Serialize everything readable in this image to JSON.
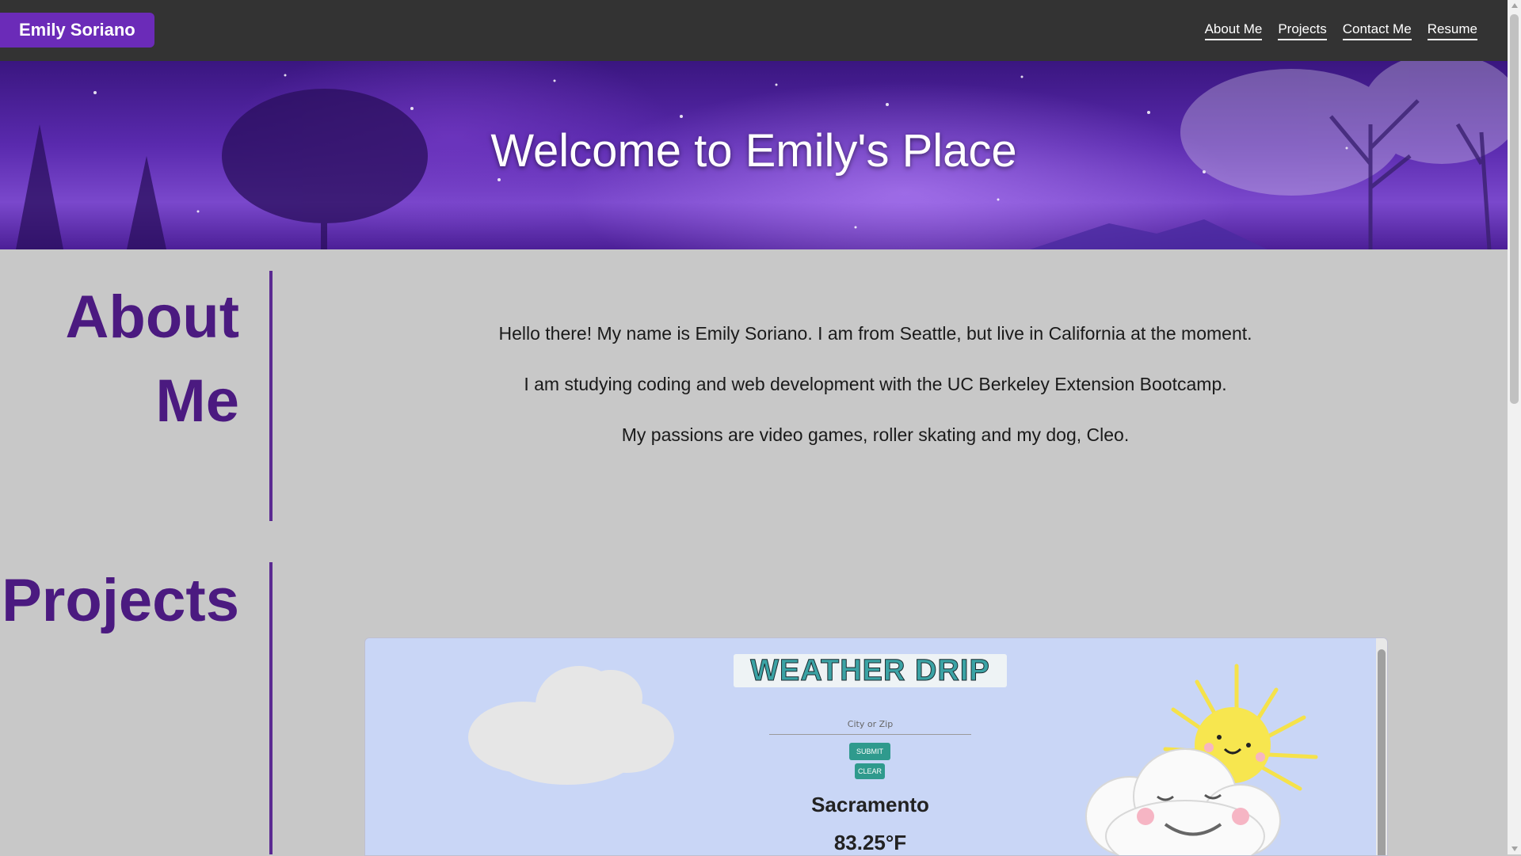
{
  "header": {
    "brand": "Emily Soriano",
    "nav": [
      "About Me",
      "Projects",
      "Contact Me",
      "Resume"
    ]
  },
  "hero": {
    "title": "Welcome to Emily's Place"
  },
  "about": {
    "title_line1": "About",
    "title_line2": "Me",
    "paragraphs": [
      "Hello there! My name is Emily Soriano. I am from Seattle, but live in California at the moment.",
      "I am studying coding and web development with the UC Berkeley Extension Bootcamp.",
      "My passions are video games, roller skating and my dog, Cleo."
    ]
  },
  "projects": {
    "title": "Projects",
    "preview": {
      "logo_text": "WEATHER DRIP",
      "input_placeholder": "City or Zip",
      "submit_label": "SUBMIT",
      "clear_label": "CLEAR",
      "city": "Sacramento",
      "temperature": "83.25°F"
    }
  },
  "colors": {
    "brand": "#6b2bb8",
    "heading": "#4b1a80",
    "topbar": "#333333",
    "accent": "#5b2a92"
  }
}
